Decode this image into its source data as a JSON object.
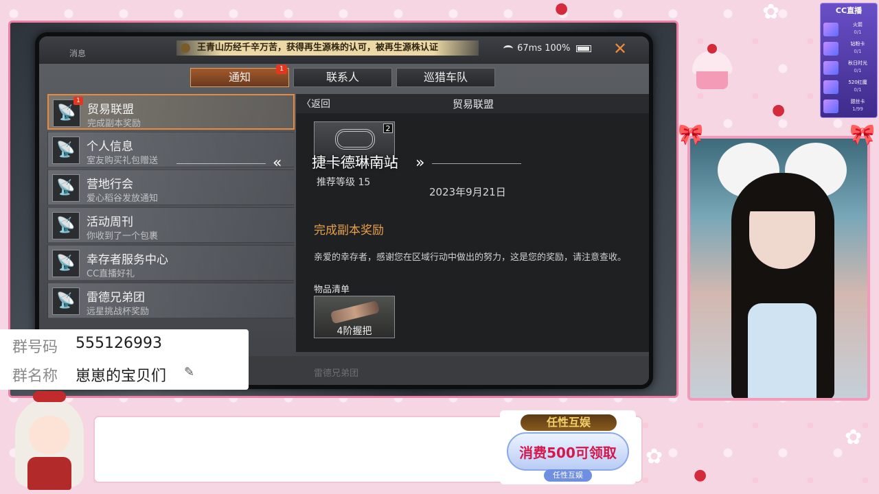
{
  "game": {
    "msg_label": "消息",
    "ticker": "王青山历经千辛万苦，获得再生源株的认可，被再生源株认证",
    "status": {
      "ping": "67ms",
      "battery": "100%"
    },
    "close": "✕",
    "tabs": [
      {
        "label": "通知",
        "badge": "1"
      },
      {
        "label": "联系人"
      },
      {
        "label": "巡猎车队"
      }
    ],
    "list": [
      {
        "title": "贸易联盟",
        "sub": "完成副本奖励",
        "badge": "1"
      },
      {
        "title": "个人信息",
        "sub": "室友购买礼包赠送"
      },
      {
        "title": "营地行会",
        "sub": "爱心稻谷发放通知"
      },
      {
        "title": "活动周刊",
        "sub": "你收到了一个包裹"
      },
      {
        "title": "幸存者服务中心",
        "sub": "CC直播好礼"
      },
      {
        "title": "雷德兄弟团",
        "sub": "远星挑战杯奖励"
      }
    ],
    "detail": {
      "back": "返回",
      "title": "贸易联盟",
      "item_count": "2",
      "level": "推荐等级  15",
      "date": "2023年9月21日",
      "reward_title": "完成副本奖励",
      "body": "亲爱的幸存者，感谢您在区域行动中做出的努力，这是您的奖励，请注意查收。",
      "list_caption": "物品清单",
      "reward_name": "4阶握把"
    },
    "location": "捷卡德琳南站",
    "faded": "雷德兄弟团"
  },
  "group": {
    "id_label": "群号码",
    "id_value": "555126993",
    "name_label": "群名称",
    "name_value": "崽崽的宝贝们"
  },
  "gift_panel": {
    "logo": "CC直播",
    "items": [
      {
        "name": "火箭",
        "count": "0/1"
      },
      {
        "name": "钻粉卡",
        "count": "0/1"
      },
      {
        "name": "秋日时光",
        "count": "0/1"
      },
      {
        "name": "520红魔",
        "count": "0/1"
      },
      {
        "name": "甜丝卡",
        "count": "1/99"
      }
    ]
  },
  "promo": {
    "brand": "任性互娱",
    "text": "消费500可领取",
    "sub": "任性互娱"
  },
  "colors": {
    "frame_pink": "#ee7fa4",
    "accent_orange": "#e98a3e",
    "badge_red": "#e3361f"
  }
}
